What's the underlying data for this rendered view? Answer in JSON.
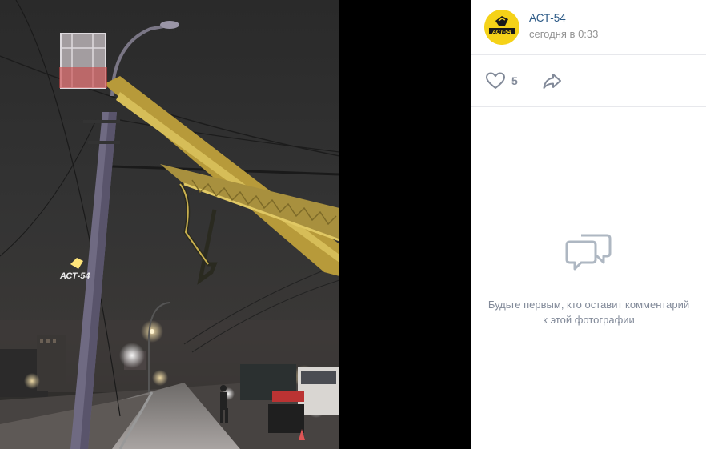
{
  "post": {
    "author": "АСТ-54",
    "time": "сегодня в 0:33",
    "likes": "5"
  },
  "photo": {
    "watermark": "АСТ-54"
  },
  "comments": {
    "empty_text": "Будьте первым, кто оставит комментарий к этой фотографии"
  },
  "icons": {
    "like": "heart-icon",
    "share": "share-arrow-icon",
    "empty": "comments-bubbles-icon"
  },
  "colors": {
    "author_link": "#2a5885",
    "avatar_bg": "#f5d218",
    "muted_text": "#828a99",
    "icon": "#828a99"
  }
}
